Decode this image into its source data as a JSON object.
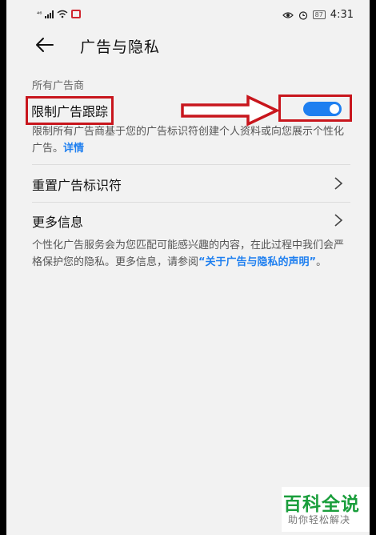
{
  "status_bar": {
    "network_label": "⁴⁶",
    "battery": "87",
    "time": "4:31"
  },
  "header": {
    "title": "广告与隐私"
  },
  "section": {
    "title": "所有广告商"
  },
  "limit_tracking": {
    "label": "限制广告跟踪",
    "enabled": true,
    "description": "限制所有广告商基于您的广告标识符创建个人资料或向您展示个性化广告。",
    "details_link": "详情"
  },
  "menu": {
    "reset_id": "重置广告标识符",
    "more_info": "更多信息"
  },
  "footer": {
    "text": "个性化广告服务会为您匹配可能感兴趣的内容，在此过程中我们会严格保护您的隐私。更多信息，请参阅",
    "link": "“关于广告与隐私的声明”",
    "end": "。"
  },
  "watermark": {
    "main": "百科全说",
    "sub": "助你轻松解决"
  },
  "colors": {
    "accent": "#1e7ff0",
    "highlight": "#c8161d",
    "watermark": "#1a9e3c"
  }
}
